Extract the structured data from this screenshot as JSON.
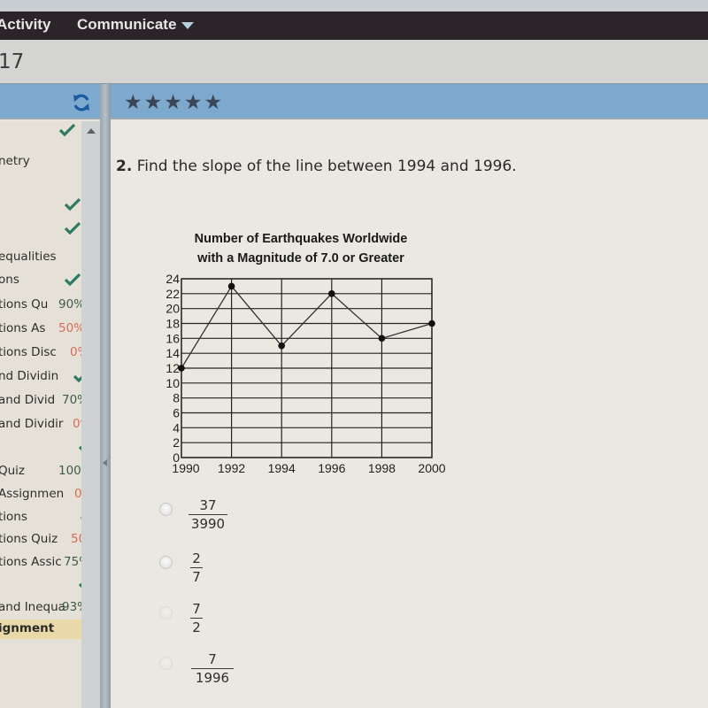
{
  "nav": {
    "items": [
      {
        "label": "Activity"
      },
      {
        "label": "Communicate"
      }
    ]
  },
  "subbar": {
    "text": "17"
  },
  "toolbar": {
    "sync_icon": "sync-icon",
    "stars": "★★★★★",
    "rating": 5
  },
  "sidebar": {
    "items": [
      {
        "label": "",
        "status": "check"
      },
      {
        "label": "netry",
        "status": ""
      },
      {
        "label": "",
        "status": "check"
      },
      {
        "label": "",
        "status": "check"
      },
      {
        "label": "equalities",
        "status": ""
      },
      {
        "label": "ons",
        "status": "check"
      },
      {
        "label": "tions Qu",
        "score": "90%",
        "score_color": "green"
      },
      {
        "label": "tions As",
        "score": "50%",
        "score_color": "red"
      },
      {
        "label": "tions Disc",
        "score": "0%",
        "score_color": "red"
      },
      {
        "label": "nd Dividin",
        "status": "check"
      },
      {
        "label": "and Divid",
        "score": "70%",
        "score_color": "green"
      },
      {
        "label": "and Dividir",
        "score": "0%",
        "score_color": "red"
      },
      {
        "label": "",
        "status": "check"
      },
      {
        "label": "Quiz",
        "score": "100%",
        "score_color": "green"
      },
      {
        "label": "Assignmen",
        "score": "0%",
        "score_color": "red"
      },
      {
        "label": "tions",
        "status": "check"
      },
      {
        "label": "tions Quiz",
        "score": "50%",
        "score_color": "red"
      },
      {
        "label": "tions Assic",
        "score": "75%",
        "score_color": "green"
      },
      {
        "label": "",
        "status": "check"
      },
      {
        "label": "and Inequa",
        "score": "93%",
        "score_color": "green"
      },
      {
        "label": "ignment",
        "status": "active"
      }
    ]
  },
  "question": {
    "number": "2.",
    "text": "Find the slope of the line between 1994 and 1996."
  },
  "chart_data": {
    "type": "line",
    "title_lines": [
      "Number of Earthquakes Worldwide",
      "with a Magnitude of 7.0 or Greater"
    ],
    "x": [
      1990,
      1992,
      1994,
      1996,
      1998,
      2000
    ],
    "values": [
      12,
      23,
      15,
      22,
      16,
      18
    ],
    "x_ticks": [
      "1990",
      "1992",
      "1994",
      "1996",
      "1998",
      "2000"
    ],
    "y_ticks": [
      "0",
      "2",
      "4",
      "6",
      "8",
      "10",
      "12",
      "14",
      "16",
      "18",
      "20",
      "22",
      "24"
    ],
    "xlabel": "",
    "ylabel": "",
    "xlim": [
      1990,
      2000
    ],
    "ylim": [
      0,
      24
    ],
    "grid": true
  },
  "choices": [
    {
      "numerator": "37",
      "denominator": "3990"
    },
    {
      "numerator": "2",
      "denominator": "7"
    },
    {
      "numerator": "7",
      "denominator": "2"
    },
    {
      "numerator": "7",
      "denominator": "1996"
    }
  ]
}
